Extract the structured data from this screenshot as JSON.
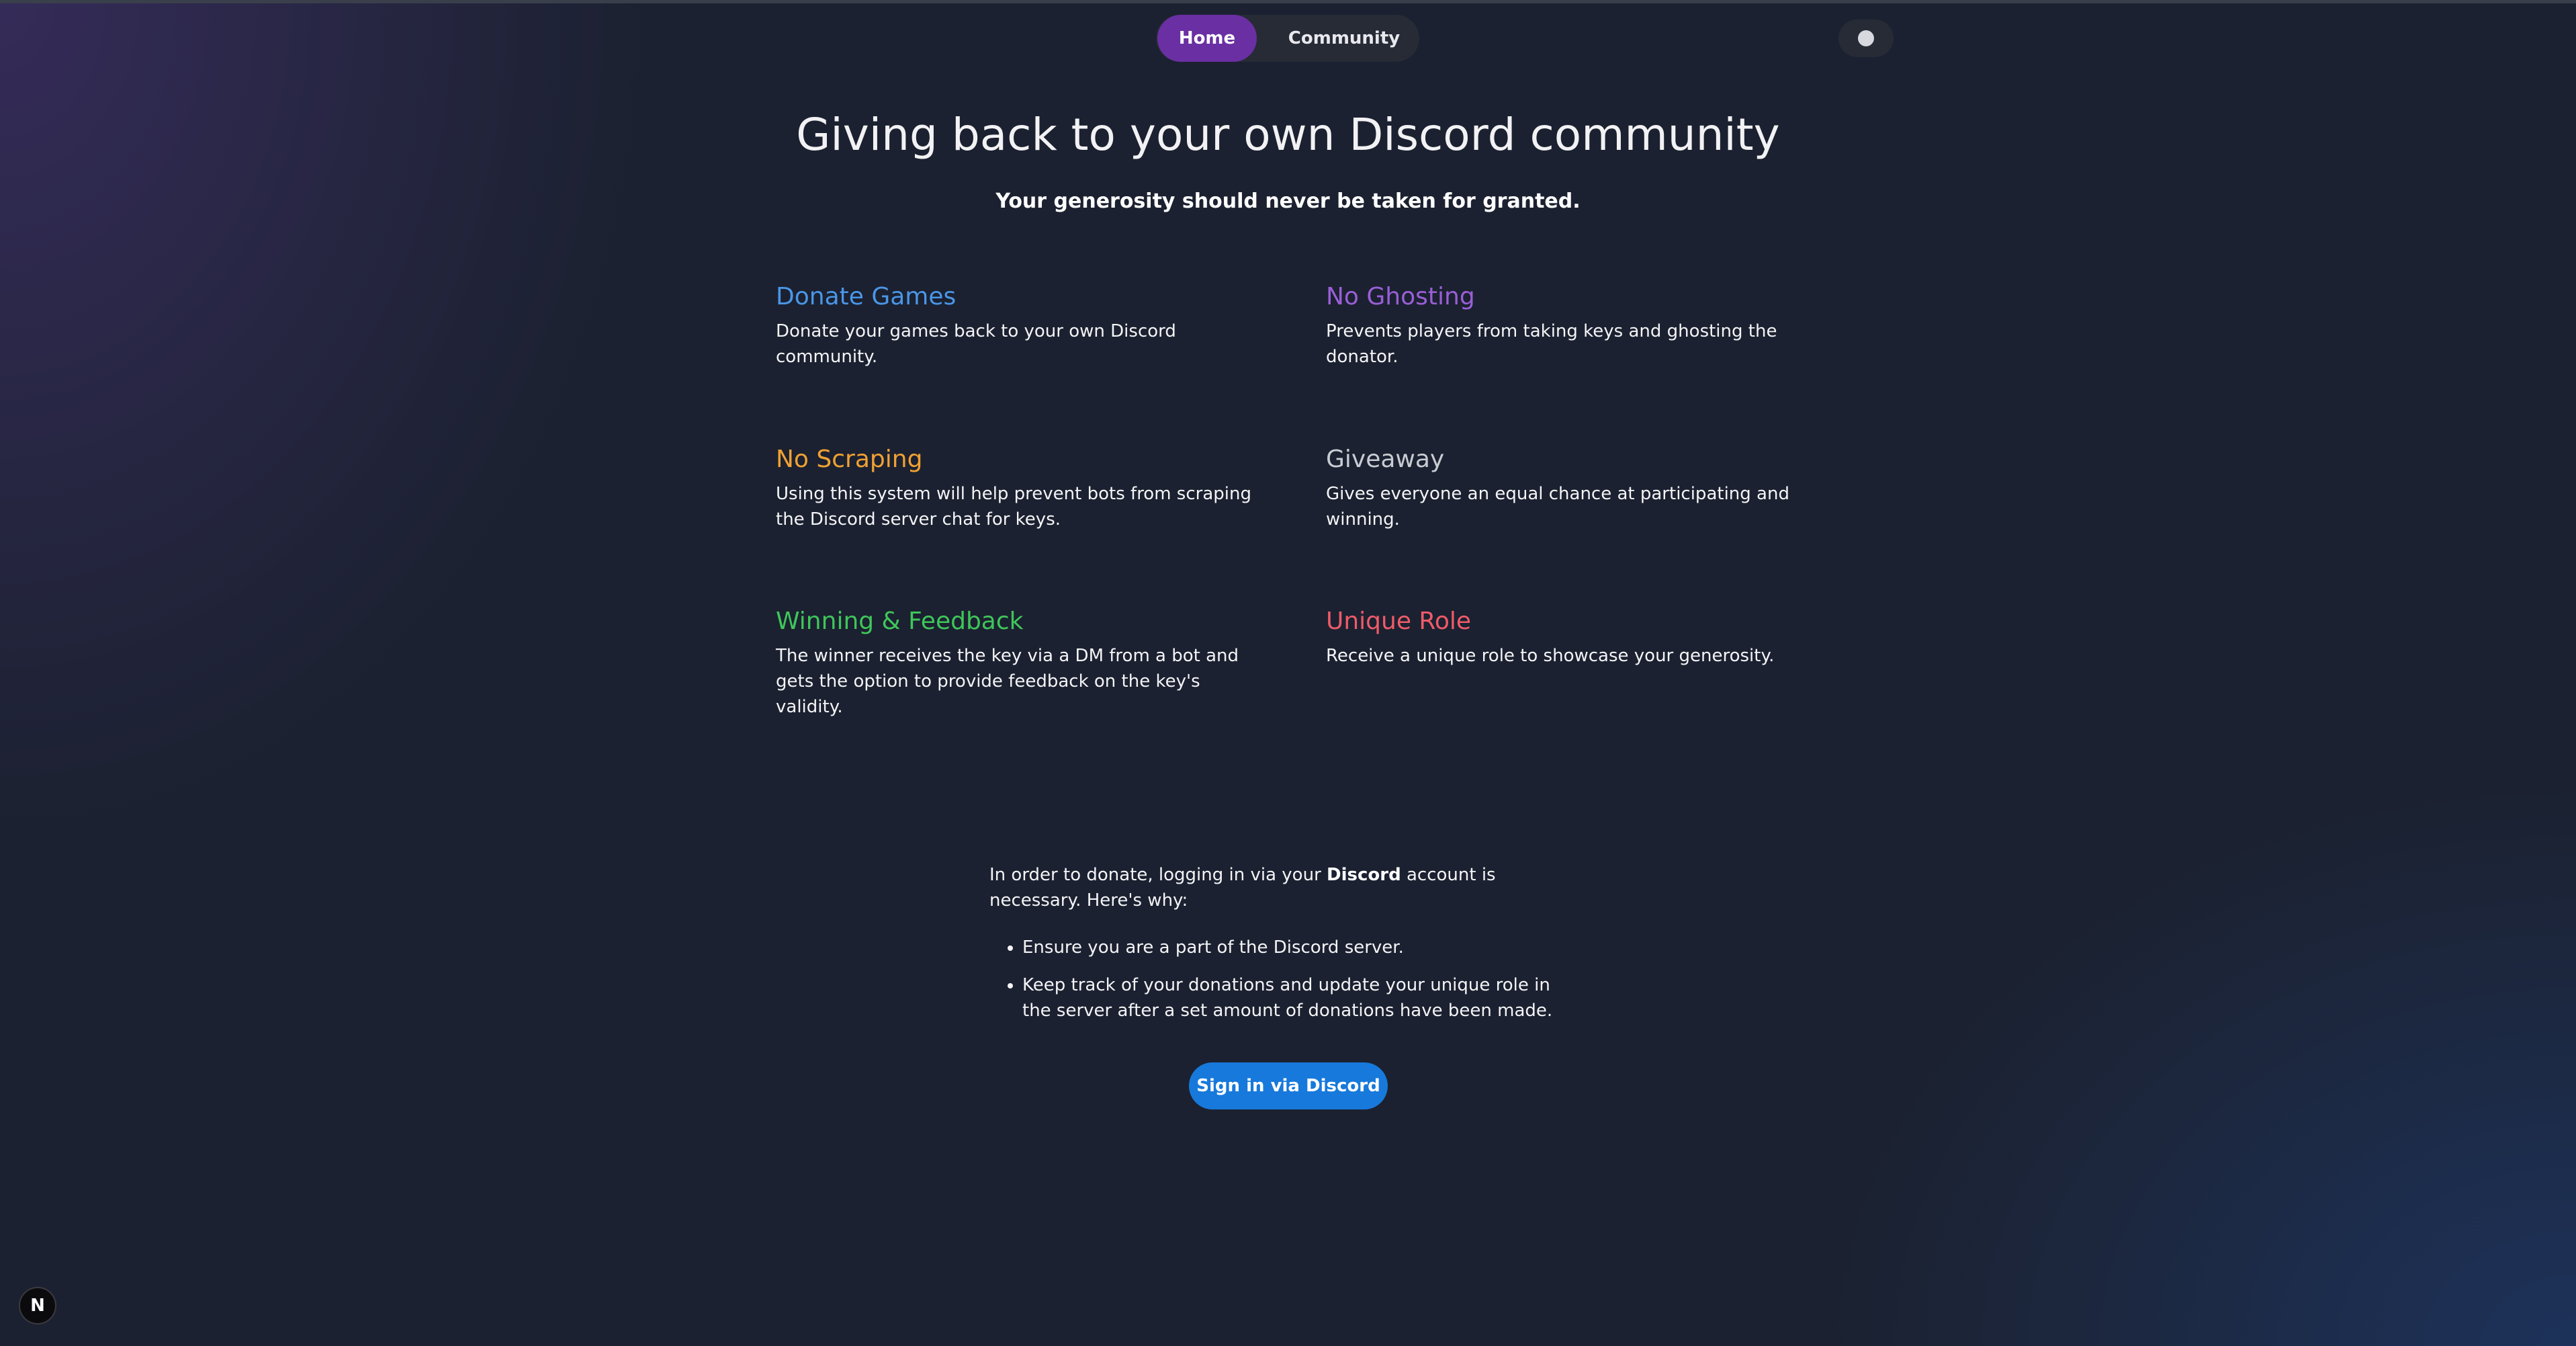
{
  "nav": {
    "items": [
      {
        "label": "Home",
        "active": true
      },
      {
        "label": "Community",
        "active": false
      }
    ]
  },
  "theme_toggle": {
    "icon": "theme-toggle-knob"
  },
  "hero": {
    "title": "Giving back to your own Discord community",
    "subtitle": "Your generosity should never be taken for granted."
  },
  "features": [
    {
      "title": "Donate Games",
      "text": "Donate your games back to your own Discord community.",
      "color": "#4a96e8"
    },
    {
      "title": "No Ghosting",
      "text": "Prevents players from taking keys and ghosting the donator.",
      "color": "#9a5fd8"
    },
    {
      "title": "No Scraping",
      "text": "Using this system will help prevent bots from scraping the Discord server chat for keys.",
      "color": "#f0a133"
    },
    {
      "title": "Giveaway",
      "text": "Gives everyone an equal chance at participating and winning.",
      "color": "#c9ccd3"
    },
    {
      "title": "Winning & Feedback",
      "text": "The winner receives the key via a DM from a bot and gets the option to provide feedback on the key's validity.",
      "color": "#3fc65a"
    },
    {
      "title": "Unique Role",
      "text": "Receive a unique role to showcase your generosity.",
      "color": "#ef5b6a"
    }
  ],
  "login": {
    "intro_before": "In order to donate, logging in via your ",
    "intro_bold": "Discord",
    "intro_after": " account is necessary. Here's why:",
    "reasons": [
      "Ensure you are a part of the Discord server.",
      "Keep track of your donations and update your unique role in the server after a set amount of donations have been made."
    ],
    "button_label": "Sign in via Discord",
    "button_color": "#1779db"
  },
  "badge": {
    "label": "N"
  }
}
